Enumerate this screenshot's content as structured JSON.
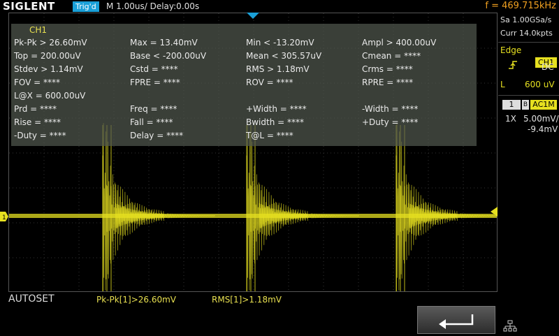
{
  "brand": "SIGLENT",
  "top": {
    "trig_status": "Trig'd",
    "timebase": "M 1.00us/  Delay:0.00s",
    "frequency": "f = 469.715kHz"
  },
  "measurements": {
    "channel": "CH1",
    "rows": [
      [
        "Pk-Pk > 26.60mV",
        "Max = 13.40mV",
        "Min < -13.20mV",
        "Ampl > 400.00uV"
      ],
      [
        "Top = 200.00uV",
        "Base < -200.00uV",
        "Mean < 305.57uV",
        "Cmean = ****"
      ],
      [
        "Stdev > 1.14mV",
        "Cstd = ****",
        "RMS > 1.18mV",
        "Crms = ****"
      ],
      [
        "FOV = ****",
        "FPRE = ****",
        "ROV = ****",
        "RPRE = ****"
      ],
      [
        "L@X = 600.00uV",
        "",
        "",
        ""
      ],
      [
        "Prd = ****",
        "Freq = ****",
        "+Width = ****",
        "-Width = ****"
      ],
      [
        "Rise = ****",
        "Fall = ****",
        "Bwidth = ****",
        "+Duty = ****"
      ],
      [
        "-Duty = ****",
        "Delay = ****",
        "T@L = ****",
        ""
      ]
    ]
  },
  "acquisition": {
    "sample_rate": "Sa 1.00GSa/s",
    "memory": "Curr 14.0kpts"
  },
  "trigger": {
    "type": "Edge",
    "source": "CH1",
    "coupling": "DC",
    "level_label": "L",
    "level": "600 uV"
  },
  "channel1": {
    "number": "1",
    "bw_flag": "B",
    "coupling": "AC1M",
    "probe": "1X",
    "scale": "5.00mV/",
    "offset": "-9.4mV"
  },
  "bottom": {
    "autoset": "AUTOSET",
    "meas1": "Pk-Pk[1]>26.60mV",
    "meas2": "RMS[1]>1.18mV"
  },
  "colors": {
    "ch1": "#e6e020",
    "trig_badge": "#1aa0d8",
    "freq": "#f0a020"
  }
}
